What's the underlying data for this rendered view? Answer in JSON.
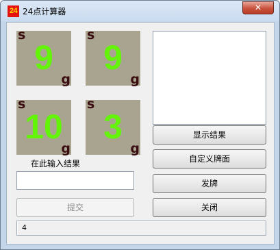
{
  "window": {
    "title": "24点计算器",
    "app_icon_text": "24",
    "close_label": "✕"
  },
  "cards": [
    {
      "suit": "s",
      "rank": "9",
      "corner": "g"
    },
    {
      "suit": "s",
      "rank": "9",
      "corner": "g"
    },
    {
      "suit": "s",
      "rank": "10",
      "corner": "g"
    },
    {
      "suit": "s",
      "rank": "3",
      "corner": "g"
    }
  ],
  "input": {
    "label": "在此输入结果",
    "value": ""
  },
  "buttons": {
    "show_result": "显示结果",
    "custom_cards": "自定义牌面",
    "deal": "发牌",
    "submit": "提交",
    "close": "关闭"
  },
  "status": {
    "text": "4"
  },
  "colors": {
    "card_background": "#a9a48f",
    "rank_color": "#63f40a",
    "suit_color": "#3a0d11",
    "icon_background": "#e4130f",
    "icon_text": "#ffd800"
  }
}
